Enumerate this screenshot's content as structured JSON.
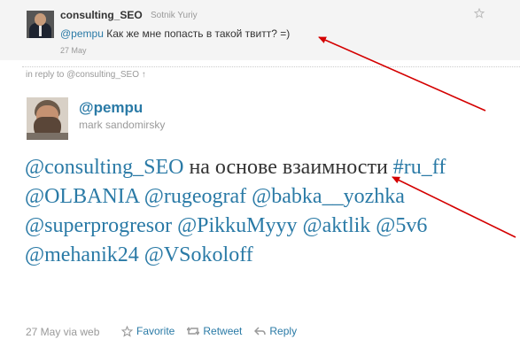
{
  "reply_to_tweet": {
    "username": "consulting_SEO",
    "fullname": "Sotnik Yuriy",
    "mention": "@pempu",
    "text": "Как же мне попасть в такой твитт? =)",
    "date": "27 May"
  },
  "in_reply_to": "in reply to @consulting_SEO ↑",
  "tweet": {
    "username": "@pempu",
    "fullname": "mark sandomirsky",
    "tokens": [
      {
        "text": "@consulting_SEO",
        "link": true
      },
      {
        "text": "на основе взаимности",
        "link": false
      },
      {
        "text": "#ru_ff",
        "link": true
      },
      {
        "text": "@OLBANIA",
        "link": true
      },
      {
        "text": "@rugeograf",
        "link": true
      },
      {
        "text": "@babka__yozhka",
        "link": true
      },
      {
        "text": "@superprogresor",
        "link": true
      },
      {
        "text": "@PikkuMyyy",
        "link": true
      },
      {
        "text": "@aktlik",
        "link": true
      },
      {
        "text": "@5v6",
        "link": true
      },
      {
        "text": "@mehanik24",
        "link": true
      },
      {
        "text": "@VSokoloff",
        "link": true
      }
    ],
    "meta": "27 May via web",
    "actions": {
      "favorite": "Favorite",
      "retweet": "Retweet",
      "reply": "Reply"
    }
  },
  "colors": {
    "link": "#2a7aa6",
    "annotation_arrow": "#d40000",
    "top_background": "#f4f4f4"
  },
  "icons": [
    "star-icon",
    "retweet-icon",
    "reply-icon",
    "favorite-star-icon"
  ]
}
